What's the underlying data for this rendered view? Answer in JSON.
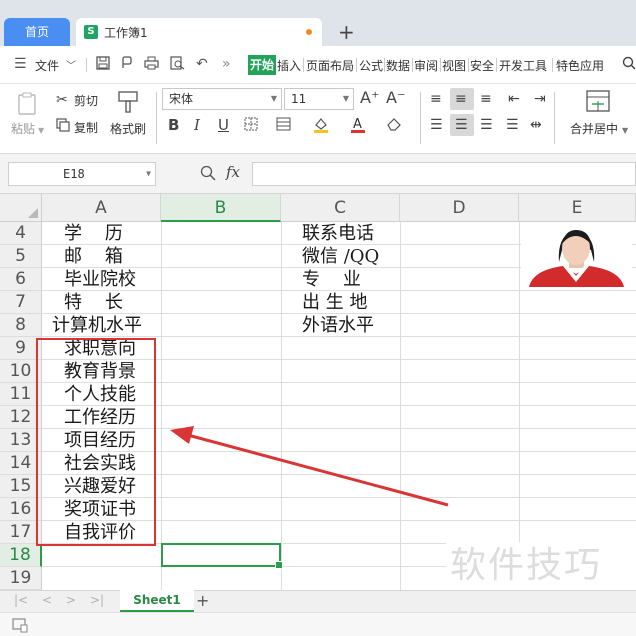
{
  "tabbar": {
    "home_label": "首页",
    "workbook_label": "工作簿1",
    "workbook_icon": "S",
    "new_tab": "+"
  },
  "menubar": {
    "file_label": "文件",
    "tabs": [
      "开始",
      "插入",
      "页面布局",
      "公式",
      "数据",
      "审阅",
      "视图",
      "安全",
      "开发工具",
      "特色应用"
    ],
    "active_tab": "开始"
  },
  "ribbon": {
    "paste_label": "粘贴",
    "cut_label": "剪切",
    "copy_label": "复制",
    "format_painter_label": "格式刷",
    "font_name": "宋体",
    "font_size": "11",
    "bold": "B",
    "italic": "I",
    "underline": "U",
    "merge_center_label": "合并居中"
  },
  "formula_bar": {
    "cell_ref": "E18",
    "fx_label": "fx",
    "value": ""
  },
  "grid": {
    "columns": [
      "A",
      "B",
      "C",
      "D",
      "E"
    ],
    "selected_column": "B",
    "rows": [
      "4",
      "5",
      "6",
      "7",
      "8",
      "9",
      "10",
      "11",
      "12",
      "13",
      "14",
      "15",
      "16",
      "17",
      "18",
      "19"
    ],
    "selected_row": "18",
    "col_a": [
      "学    历",
      "邮    箱",
      "毕业院校",
      "特    长",
      "计算机水平",
      "求职意向",
      "教育背景",
      "个人技能",
      "工作经历",
      "项目经历",
      "社会实践",
      "兴趣爱好",
      "奖项证书",
      "自我评价"
    ],
    "col_c": [
      "联系电话",
      "微信 /QQ",
      "专    业",
      "出 生 地",
      "外语水平"
    ]
  },
  "watermark": "软件技巧",
  "sheets": {
    "tabs": [
      "Sheet1"
    ],
    "add": "+"
  },
  "colors": {
    "accent_green": "#22a35a",
    "home_tab_blue": "#4a8ef2",
    "annotation_red": "#d93535"
  }
}
